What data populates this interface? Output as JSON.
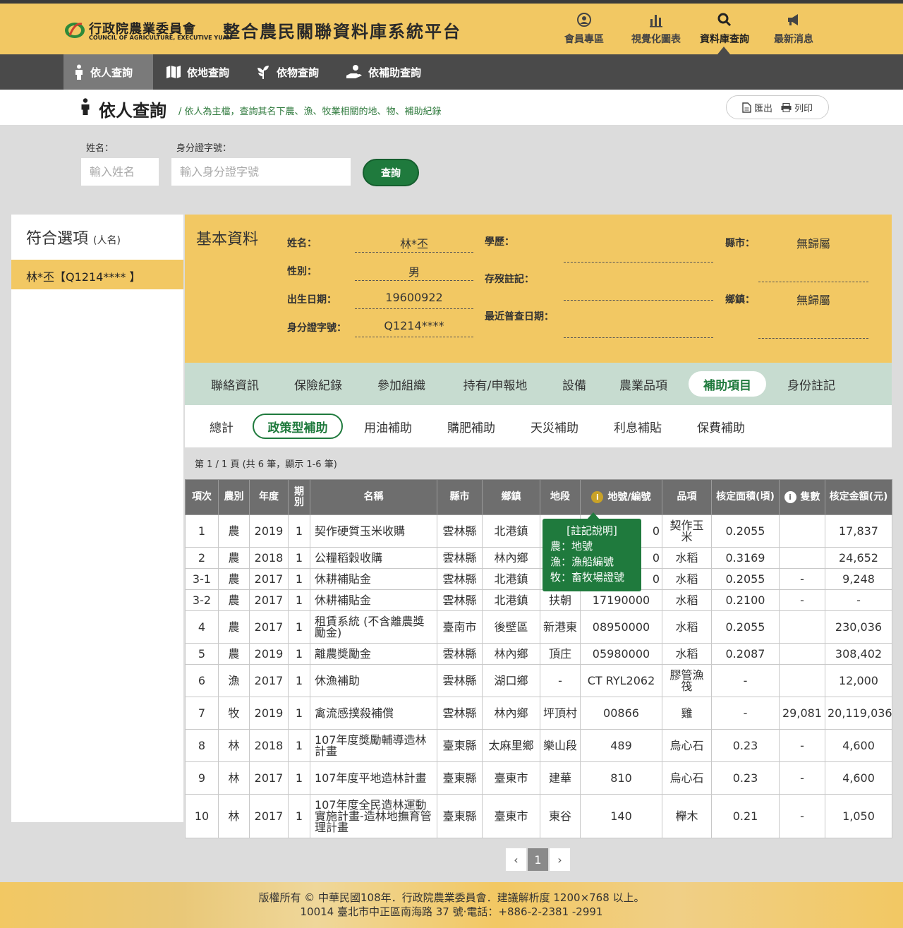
{
  "header": {
    "logo_cn": "行政院農業委員會",
    "logo_en": "COUNCIL OF AGRICULTURE, EXECUTIVE YUAN",
    "site_title": "整合農民關聯資料庫系統平台",
    "nav": [
      {
        "label": "會員專區",
        "icon": "user-icon"
      },
      {
        "label": "視覺化圖表",
        "icon": "bar-chart-icon"
      },
      {
        "label": "資料庫查詢",
        "icon": "search-icon"
      },
      {
        "label": "最新消息",
        "icon": "megaphone-icon"
      }
    ]
  },
  "subnav": [
    {
      "label": "依人查詢",
      "icon": "person-icon"
    },
    {
      "label": "依地查詢",
      "icon": "map-icon"
    },
    {
      "label": "依物查詢",
      "icon": "plant-icon"
    },
    {
      "label": "依補助查詢",
      "icon": "hand-money-icon"
    }
  ],
  "page": {
    "title": "依人查詢",
    "desc": "/ 依人為主檔，查詢其名下農、漁、牧業相關的地、物、補助紀錄",
    "export_label": "匯出",
    "print_label": "列印"
  },
  "search": {
    "name_label": "姓名：",
    "name_placeholder": "輸入姓名",
    "id_label": "身分證字號：",
    "id_placeholder": "輸入身分證字號",
    "button": "查詢"
  },
  "matches": {
    "title": "符合選項",
    "title_small": "(人名)",
    "items": [
      "林*丕【Q1214**** 】"
    ]
  },
  "basic": {
    "title": "基本資料",
    "name_label": "姓名：",
    "name": "林*丕",
    "gender_label": "性別：",
    "gender": "男",
    "birth_label": "出生日期：",
    "birth": "19600922",
    "id_label": "身分證字號：",
    "id": "Q1214****",
    "edu_label": "學歷：",
    "alive_label": "存歿註記：",
    "census_label": "最近普查日期：",
    "county_label": "縣市：",
    "county": "無歸屬",
    "town_label": "鄉鎮：",
    "town": "無歸屬"
  },
  "tabs": [
    "聯絡資訊",
    "保險紀錄",
    "參加組織",
    "持有/申報地",
    "設備",
    "農業品項",
    "補助項目",
    "身份註記"
  ],
  "subtabs": [
    "總計",
    "政策型補助",
    "用油補助",
    "購肥補助",
    "天災補助",
    "利息補貼",
    "保費補助"
  ],
  "pageinfo": "第 1 / 1 頁  (共 6 筆，顯示 1-6 筆)",
  "table": {
    "headers": [
      "項次",
      "農別",
      "年度",
      "期別",
      "名稱",
      "縣市",
      "鄉鎮",
      "地段",
      "地號/編號",
      "品項",
      "核定面積(頃)",
      "隻數",
      "核定金額(元)"
    ],
    "rows": [
      [
        "1",
        "農",
        "2019",
        "1",
        "契作硬質玉米收購",
        "雲林縣",
        "北港鎮",
        "",
        "0",
        "契作玉米",
        "0.2055",
        "",
        "17,837"
      ],
      [
        "2",
        "農",
        "2018",
        "1",
        "公糧稻穀收購",
        "雲林縣",
        "林內鄉",
        "",
        "0",
        "水稻",
        "0.3169",
        "",
        "24,652"
      ],
      [
        "3-1",
        "農",
        "2017",
        "1",
        "休耕補貼金",
        "雲林縣",
        "北港鎮",
        "",
        "0",
        "水稻",
        "0.2055",
        "-",
        "9,248"
      ],
      [
        "3-2",
        "農",
        "2017",
        "1",
        "休耕補貼金",
        "雲林縣",
        "北港鎮",
        "扶朝",
        "17190000",
        "水稻",
        "0.2100",
        "-",
        "-"
      ],
      [
        "4",
        "農",
        "2017",
        "1",
        "租賃系統 (不含離農獎勵金)",
        "臺南市",
        "後壁區",
        "新港東",
        "08950000",
        "水稻",
        "0.2055",
        "",
        "230,036"
      ],
      [
        "5",
        "農",
        "2019",
        "1",
        "離農獎勵金",
        "雲林縣",
        "林內鄉",
        "頂庄",
        "05980000",
        "水稻",
        "0.2087",
        "",
        "308,402"
      ],
      [
        "6",
        "漁",
        "2017",
        "1",
        "休漁補助",
        "雲林縣",
        "湖口鄉",
        "-",
        "CT RYL2062",
        "膠管漁筏",
        "-",
        "",
        "12,000"
      ],
      [
        "7",
        "牧",
        "2019",
        "1",
        "禽流感撲殺補償",
        "雲林縣",
        "林內鄉",
        "坪頂村",
        "00866",
        "雞",
        "-",
        "29,081",
        "20,119,036"
      ],
      [
        "8",
        "林",
        "2018",
        "1",
        "107年度獎勵輔導造林計畫",
        "臺東縣",
        "太麻里鄉",
        "樂山段",
        "489",
        "烏心石",
        "0.23",
        "-",
        "4,600"
      ],
      [
        "9",
        "林",
        "2017",
        "1",
        "107年度平地造林計畫",
        "臺東縣",
        "臺東市",
        "建華",
        "810",
        "烏心石",
        "0.23",
        "-",
        "4,600"
      ],
      [
        "10",
        "林",
        "2017",
        "1",
        "107年度全民造林運動實施計畫-造林地撫育管理計畫",
        "臺東縣",
        "臺東市",
        "東谷",
        "140",
        "櫸木",
        "0.21",
        "-",
        "1,050"
      ]
    ]
  },
  "tooltip": {
    "title": "[註記說明]",
    "lines": [
      "農：地號",
      "漁：漁船編號",
      "牧：畜牧場證號"
    ]
  },
  "pager": {
    "current": "1",
    "prev": "‹",
    "next": "›"
  },
  "footer": {
    "line1": "版權所有 © 中華民國108年．行政院農業委員會．建議解析度 1200×768 以上。",
    "line2": "10014 臺北市中正區南海路 37 號‧電話：+886-2-2381 -2991"
  },
  "colors": {
    "brand_yellow": "#f2c863",
    "brand_green": "#1f7a3d",
    "tab_bg": "#c7dcd0",
    "dark_nav": "#4a4a4a"
  }
}
